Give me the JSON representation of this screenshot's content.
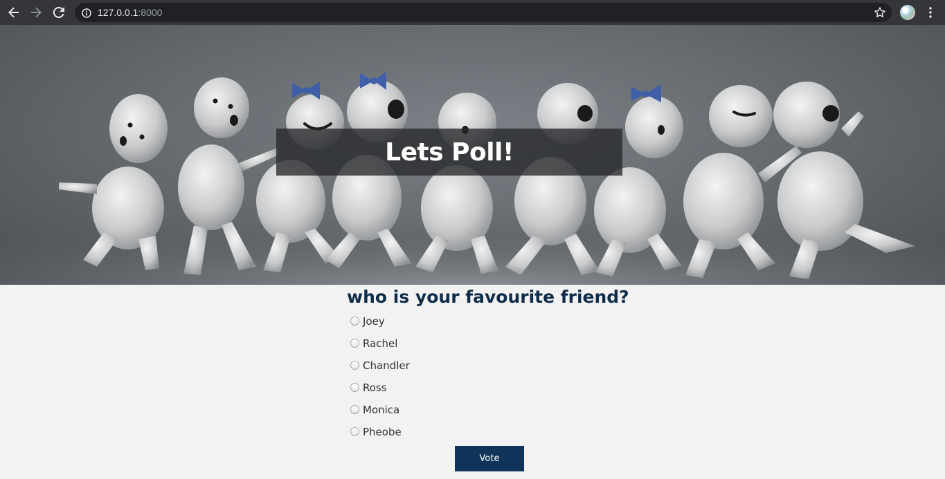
{
  "browser": {
    "url_host": "127.0.0.1",
    "url_port": ":8000"
  },
  "hero": {
    "title": "Lets Poll!"
  },
  "poll": {
    "question": "who is your favourite friend?",
    "options": [
      "Joey",
      "Rachel",
      "Chandler",
      "Ross",
      "Monica",
      "Pheobe"
    ],
    "vote_label": "Vote"
  },
  "colors": {
    "vote_button": "#0f3359",
    "question_text": "#0f2d48",
    "page_background": "#f2f2f2"
  }
}
